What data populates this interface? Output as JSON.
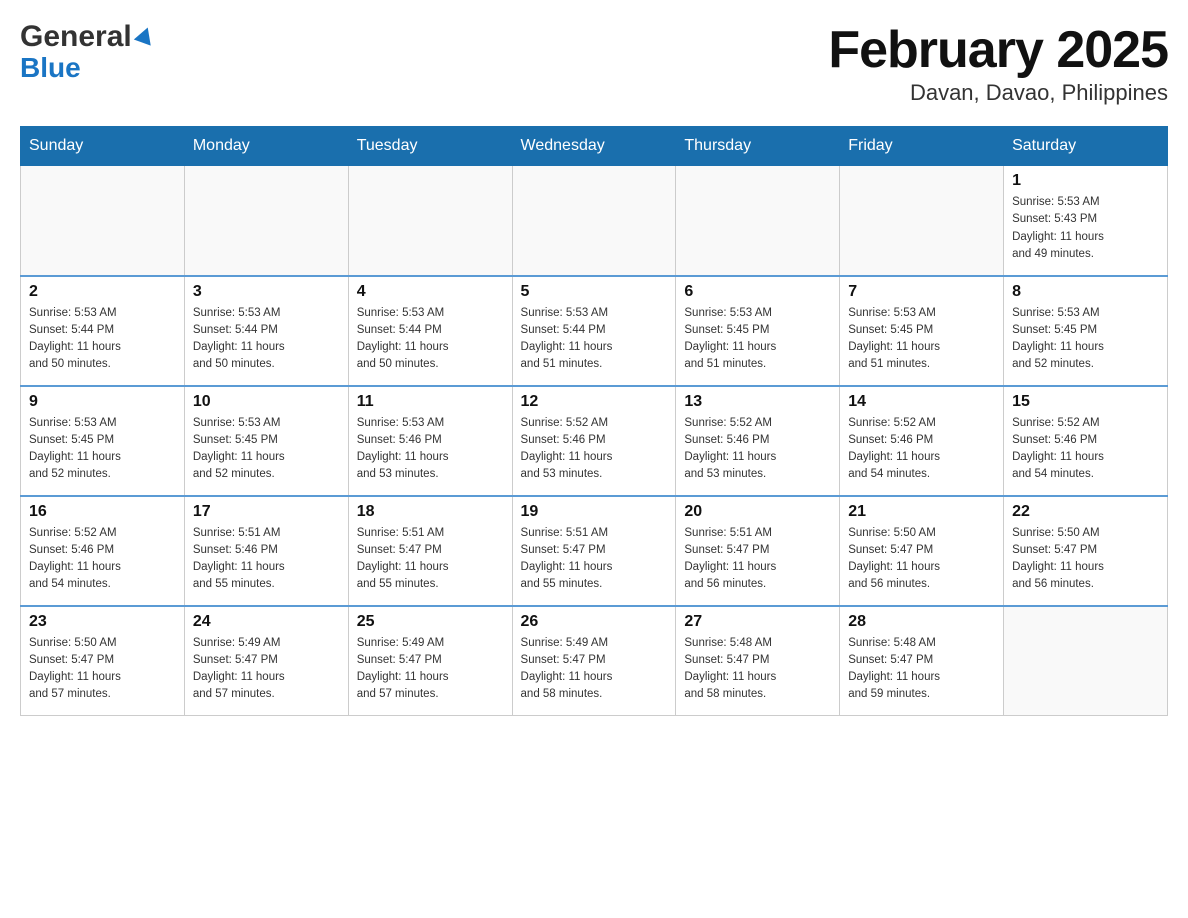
{
  "header": {
    "logo_general": "General",
    "logo_blue": "Blue",
    "title": "February 2025",
    "subtitle": "Davan, Davao, Philippines"
  },
  "calendar": {
    "days_of_week": [
      "Sunday",
      "Monday",
      "Tuesday",
      "Wednesday",
      "Thursday",
      "Friday",
      "Saturday"
    ],
    "weeks": [
      [
        {
          "day": "",
          "info": ""
        },
        {
          "day": "",
          "info": ""
        },
        {
          "day": "",
          "info": ""
        },
        {
          "day": "",
          "info": ""
        },
        {
          "day": "",
          "info": ""
        },
        {
          "day": "",
          "info": ""
        },
        {
          "day": "1",
          "info": "Sunrise: 5:53 AM\nSunset: 5:43 PM\nDaylight: 11 hours\nand 49 minutes."
        }
      ],
      [
        {
          "day": "2",
          "info": "Sunrise: 5:53 AM\nSunset: 5:44 PM\nDaylight: 11 hours\nand 50 minutes."
        },
        {
          "day": "3",
          "info": "Sunrise: 5:53 AM\nSunset: 5:44 PM\nDaylight: 11 hours\nand 50 minutes."
        },
        {
          "day": "4",
          "info": "Sunrise: 5:53 AM\nSunset: 5:44 PM\nDaylight: 11 hours\nand 50 minutes."
        },
        {
          "day": "5",
          "info": "Sunrise: 5:53 AM\nSunset: 5:44 PM\nDaylight: 11 hours\nand 51 minutes."
        },
        {
          "day": "6",
          "info": "Sunrise: 5:53 AM\nSunset: 5:45 PM\nDaylight: 11 hours\nand 51 minutes."
        },
        {
          "day": "7",
          "info": "Sunrise: 5:53 AM\nSunset: 5:45 PM\nDaylight: 11 hours\nand 51 minutes."
        },
        {
          "day": "8",
          "info": "Sunrise: 5:53 AM\nSunset: 5:45 PM\nDaylight: 11 hours\nand 52 minutes."
        }
      ],
      [
        {
          "day": "9",
          "info": "Sunrise: 5:53 AM\nSunset: 5:45 PM\nDaylight: 11 hours\nand 52 minutes."
        },
        {
          "day": "10",
          "info": "Sunrise: 5:53 AM\nSunset: 5:45 PM\nDaylight: 11 hours\nand 52 minutes."
        },
        {
          "day": "11",
          "info": "Sunrise: 5:53 AM\nSunset: 5:46 PM\nDaylight: 11 hours\nand 53 minutes."
        },
        {
          "day": "12",
          "info": "Sunrise: 5:52 AM\nSunset: 5:46 PM\nDaylight: 11 hours\nand 53 minutes."
        },
        {
          "day": "13",
          "info": "Sunrise: 5:52 AM\nSunset: 5:46 PM\nDaylight: 11 hours\nand 53 minutes."
        },
        {
          "day": "14",
          "info": "Sunrise: 5:52 AM\nSunset: 5:46 PM\nDaylight: 11 hours\nand 54 minutes."
        },
        {
          "day": "15",
          "info": "Sunrise: 5:52 AM\nSunset: 5:46 PM\nDaylight: 11 hours\nand 54 minutes."
        }
      ],
      [
        {
          "day": "16",
          "info": "Sunrise: 5:52 AM\nSunset: 5:46 PM\nDaylight: 11 hours\nand 54 minutes."
        },
        {
          "day": "17",
          "info": "Sunrise: 5:51 AM\nSunset: 5:46 PM\nDaylight: 11 hours\nand 55 minutes."
        },
        {
          "day": "18",
          "info": "Sunrise: 5:51 AM\nSunset: 5:47 PM\nDaylight: 11 hours\nand 55 minutes."
        },
        {
          "day": "19",
          "info": "Sunrise: 5:51 AM\nSunset: 5:47 PM\nDaylight: 11 hours\nand 55 minutes."
        },
        {
          "day": "20",
          "info": "Sunrise: 5:51 AM\nSunset: 5:47 PM\nDaylight: 11 hours\nand 56 minutes."
        },
        {
          "day": "21",
          "info": "Sunrise: 5:50 AM\nSunset: 5:47 PM\nDaylight: 11 hours\nand 56 minutes."
        },
        {
          "day": "22",
          "info": "Sunrise: 5:50 AM\nSunset: 5:47 PM\nDaylight: 11 hours\nand 56 minutes."
        }
      ],
      [
        {
          "day": "23",
          "info": "Sunrise: 5:50 AM\nSunset: 5:47 PM\nDaylight: 11 hours\nand 57 minutes."
        },
        {
          "day": "24",
          "info": "Sunrise: 5:49 AM\nSunset: 5:47 PM\nDaylight: 11 hours\nand 57 minutes."
        },
        {
          "day": "25",
          "info": "Sunrise: 5:49 AM\nSunset: 5:47 PM\nDaylight: 11 hours\nand 57 minutes."
        },
        {
          "day": "26",
          "info": "Sunrise: 5:49 AM\nSunset: 5:47 PM\nDaylight: 11 hours\nand 58 minutes."
        },
        {
          "day": "27",
          "info": "Sunrise: 5:48 AM\nSunset: 5:47 PM\nDaylight: 11 hours\nand 58 minutes."
        },
        {
          "day": "28",
          "info": "Sunrise: 5:48 AM\nSunset: 5:47 PM\nDaylight: 11 hours\nand 59 minutes."
        },
        {
          "day": "",
          "info": ""
        }
      ]
    ]
  }
}
